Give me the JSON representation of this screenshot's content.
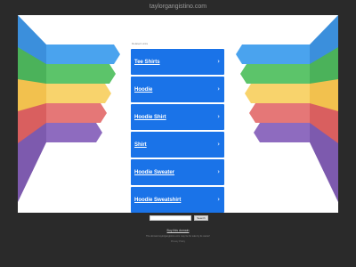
{
  "site": {
    "domain": "taylorgangistino.com"
  },
  "related": {
    "label": "Related Links",
    "items": [
      {
        "label": "Tee Shirts"
      },
      {
        "label": "Hoodie"
      },
      {
        "label": "Hoodie Shirt"
      },
      {
        "label": "Shirt"
      },
      {
        "label": "Hoodie Sweater"
      },
      {
        "label": "Hoodie Sweatshirt"
      }
    ]
  },
  "footer": {
    "search_button": "Search",
    "buy_text": "Buy this domain",
    "owner_text": "The domain taylorgangistino.com may be for sale by its owner!",
    "privacy_text": "Privacy Policy"
  },
  "colors": {
    "tile": "#1a73e8",
    "ribbons": [
      "#4aa3ee",
      "#5cc46a",
      "#f8d36c",
      "#e57777",
      "#8e6bbf"
    ]
  }
}
